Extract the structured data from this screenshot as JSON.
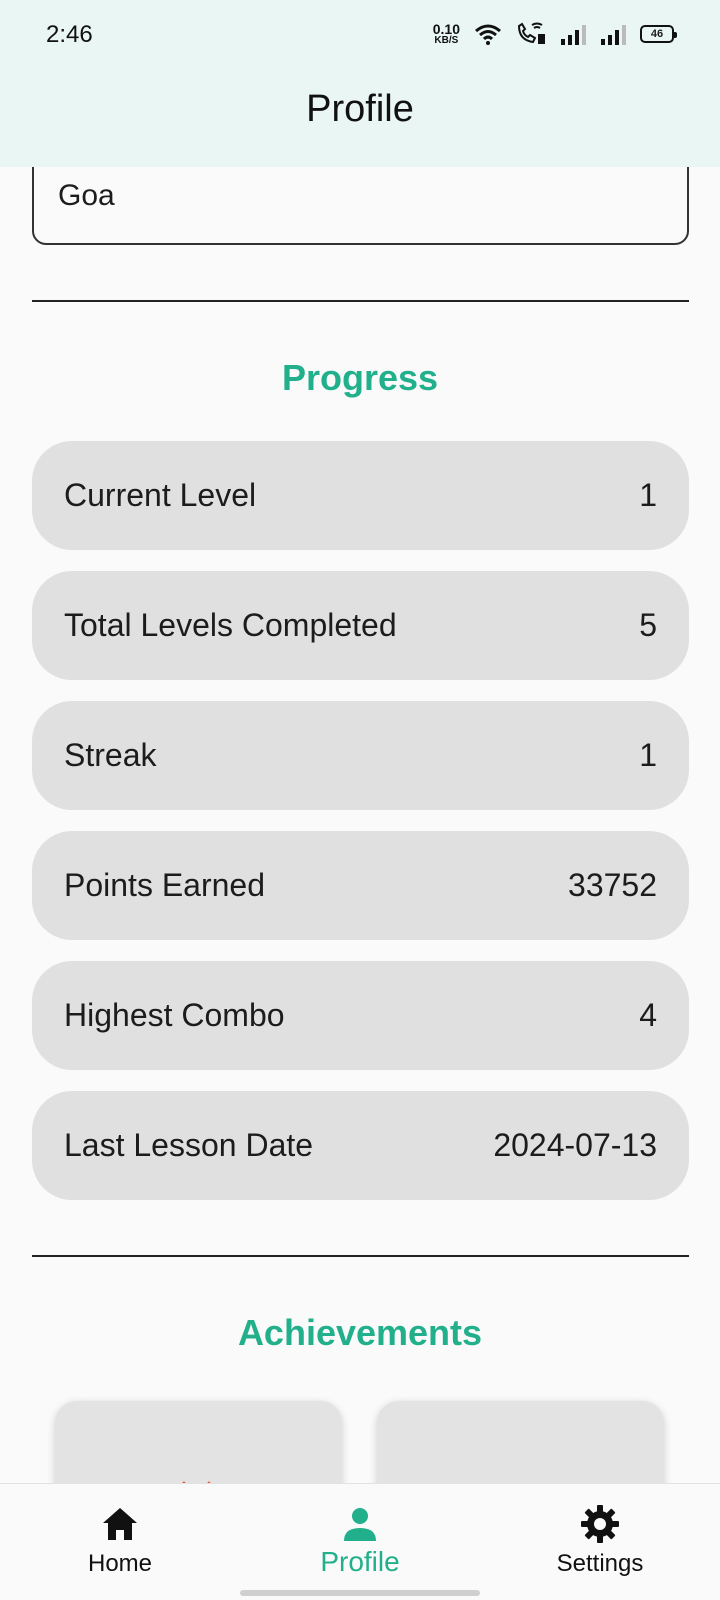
{
  "status_bar": {
    "time": "2:46",
    "net_speed_value": "0.10",
    "net_speed_unit": "KB/S",
    "battery_level": "46"
  },
  "header": {
    "title": "Profile"
  },
  "location": {
    "value": "Goa"
  },
  "progress": {
    "title": "Progress",
    "stats": [
      {
        "label": "Current Level",
        "value": "1"
      },
      {
        "label": "Total Levels Completed",
        "value": "5"
      },
      {
        "label": "Streak",
        "value": "1"
      },
      {
        "label": "Points Earned",
        "value": "33752"
      },
      {
        "label": "Highest Combo",
        "value": "4"
      },
      {
        "label": "Last Lesson Date",
        "value": "2024-07-13"
      }
    ]
  },
  "achievements": {
    "title": "Achievements"
  },
  "bottom_nav": {
    "items": [
      {
        "label": "Home",
        "icon": "home-icon"
      },
      {
        "label": "Profile",
        "icon": "person-icon",
        "active": true
      },
      {
        "label": "Settings",
        "icon": "gear-icon"
      }
    ]
  },
  "colors": {
    "accent": "#21b08b",
    "header_bg": "#e9f6f3",
    "row_bg": "#e0e0e0"
  }
}
